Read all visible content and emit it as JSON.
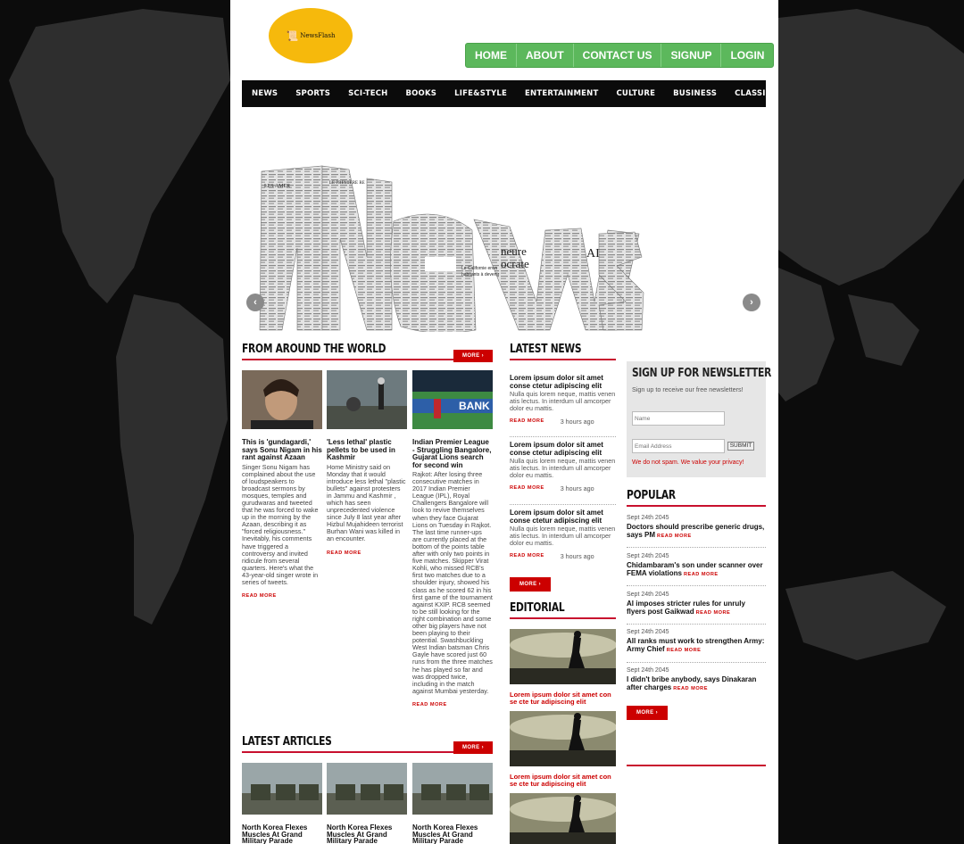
{
  "colors": {
    "accent": "#c8102e",
    "nav_green": "#5cb85c",
    "logo_yellow": "#f6b90c"
  },
  "logo": {
    "text": "NewsFlash",
    "icon": "scroll-icon"
  },
  "top_nav": [
    "HOME",
    "ABOUT",
    "CONTACT US",
    "SIGNUP",
    "LOGIN"
  ],
  "categories": [
    "NEWS",
    "SPORTS",
    "SCI-TECH",
    "BOOKS",
    "LIFE&STYLE",
    "ENTERTAINMENT",
    "CULTURE",
    "BUSINESS",
    "CLASSIFIEDS"
  ],
  "slider": {
    "prev_icon": "chevron-left-icon",
    "next_icon": "chevron-right-icon",
    "hero_text": "NEWS",
    "paper_headlines": [
      "LES AMER",
      "LE PREMIERE RE",
      "neure",
      "ocrate",
      "AI",
      "Le Californie envo",
      "habitants à devenir"
    ]
  },
  "world": {
    "heading": "FROM AROUND THE WORLD",
    "more": "MORE",
    "articles": [
      {
        "title": "This is 'gundagardi,' says Sonu Nigam in his rant against Azaan",
        "body": "Singer Sonu Nigam has complained about the use of loudspeakers to broadcast sermons by mosques, temples and gurudwaras and tweeted that he was forced to wake up in the morning by the Azaan, describing it as \"forced religiousness.\" Inevitably, his comments have triggered a controversy and invited ridicule from several quarters. Here's what the 43-year-old singer wrote in series of tweets.",
        "read_more": "READ MORE"
      },
      {
        "title": "'Less lethal' plastic pellets to be used in Kashmir",
        "body": "Home Ministry said on Monday that it would introduce less lethal \"plastic bullets\" against protesters in Jammu and Kashmir , which has seen unprecedented violence since July 8 last year after Hizbul Mujahideen terrorist Burhan Wani was killed in an encounter.",
        "read_more": "READ MORE"
      },
      {
        "title": "Indian Premier League - Struggling Bangalore, Gujarat Lions search for second win",
        "body": "Rajkot: After losing three consecutive matches in 2017 Indian Premier League (IPL), Royal Challengers Bangalore will look to revive themselves when they face Gujarat Lions on Tuesday in Rajkot. The last time runner-ups are currently placed at the bottom of the points table after with only two points in five matches. Skipper Virat Kohli, who missed RCB's first two matches due to a shoulder injury, showed his class as he scored 62 in his first game of the tournament against KXIP. RCB seemed to be still looking for the right combination and some other big players have not been playing to their potential. Swashbuckling West Indian batsman Chris Gayle have scored just 60 runs from the three matches he has played so far and was dropped twice, including in the match against Mumbai yesterday.",
        "read_more": "READ MORE",
        "thumb_text": "BANK"
      }
    ]
  },
  "latest_articles": {
    "heading": "LATEST ARTICLES",
    "more": "MORE",
    "items": [
      {
        "title": "North Korea Flexes Muscles At Grand Military Parade"
      },
      {
        "title": "North Korea Flexes Muscles At Grand Military Parade"
      },
      {
        "title": "North Korea Flexes Muscles At Grand Military Parade"
      }
    ]
  },
  "latest_news": {
    "heading": "LATEST NEWS",
    "more": "MORE",
    "items": [
      {
        "title": "Lorem ipsum dolor sit amet conse ctetur adipiscing elit",
        "body": "Nulla quis lorem neque, mattis venen atis lectus. In interdum ull amcorper dolor eu mattis.",
        "read_more": "READ MORE",
        "time": "3 hours ago"
      },
      {
        "title": "Lorem ipsum dolor sit amet conse ctetur adipiscing elit",
        "body": "Nulla quis lorem neque, mattis venen atis lectus. In interdum ull amcorper dolor eu mattis.",
        "read_more": "READ MORE",
        "time": "3 hours ago"
      },
      {
        "title": "Lorem ipsum dolor sit amet conse ctetur adipiscing elit",
        "body": "Nulla quis lorem neque, mattis venen atis lectus. In interdum ull amcorper dolor eu mattis.",
        "read_more": "READ MORE",
        "time": "3 hours ago"
      }
    ]
  },
  "editorial": {
    "heading": "EDITORIAL",
    "items": [
      {
        "caption": "Lorem ipsum dolor sit amet con se cte tur adipiscing elit"
      },
      {
        "caption": "Lorem ipsum dolor sit amet con se cte tur adipiscing elit"
      }
    ]
  },
  "newsletter": {
    "heading": "SIGN UP FOR NEWSLETTER",
    "subtitle": "Sign up to receive our free newsletters!",
    "name_placeholder": "Name",
    "email_placeholder": "Email Address",
    "submit": "SUBMIT",
    "privacy": "We do not spam. We value your privacy!"
  },
  "popular": {
    "heading": "POPULAR",
    "more": "MORE",
    "read_more": "READ MORE",
    "items": [
      {
        "date": "Sept 24th 2045",
        "title": "Doctors should prescribe generic drugs, says PM"
      },
      {
        "date": "Sept 24th 2045",
        "title": "Chidambaram's son under scanner over FEMA violations"
      },
      {
        "date": "Sept 24th 2045",
        "title": "AI imposes stricter rules for unruly flyers post Gaikwad"
      },
      {
        "date": "Sept 24th 2045",
        "title": "All ranks must work to strengthen Army: Army Chief"
      },
      {
        "date": "Sept 24th 2045",
        "title": "I didn't bribe anybody, says Dinakaran after charges"
      }
    ]
  }
}
